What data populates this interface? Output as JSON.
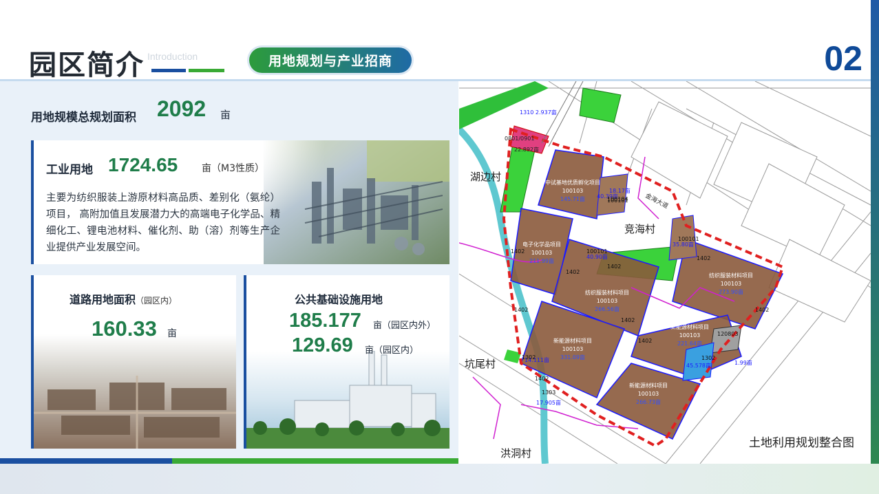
{
  "header": {
    "title": "园区简介",
    "subtitle_en": "Introduction",
    "pill": "用地规划与产业招商",
    "page_number": "02"
  },
  "total": {
    "label": "用地规模总规划面积",
    "value": "2092",
    "unit": "亩"
  },
  "industrial": {
    "label": "工业用地",
    "value": "1724.65",
    "unit": "亩（M3性质）",
    "description": "主要为纺织服装上游原材料高品质、差别化（氨纶）项目， 高附加值且发展潜力大的高端电子化学品、精细化工、锂电池材料、催化剂、助（溶）剂等生产企业提供产业发展空间。"
  },
  "road": {
    "label": "道路用地面积",
    "note": "（园区内）",
    "value": "160.33",
    "unit": "亩"
  },
  "public": {
    "label": "公共基础设施用地",
    "value1": "185.177",
    "unit1": "亩（园区内外）",
    "value2": "129.69",
    "unit2": "亩（园区内）"
  },
  "map": {
    "caption": "土地利用规划整合图",
    "villages": [
      "湖边村",
      "竞海村",
      "坑尾村",
      "洪洞村"
    ],
    "road_name": "金海大道",
    "plots": [
      {
        "name": "中试基地优质孵化项目",
        "code": "100103",
        "area": "145.71亩"
      },
      {
        "name": "电子化学品项目",
        "code": "100103",
        "area": "211.99亩"
      },
      {
        "name": "纺织服装材料项目",
        "code": "100103",
        "area": "266.56亩"
      },
      {
        "name": "纺织服装材料项目",
        "code": "100103",
        "area": "273.90亩"
      },
      {
        "name": "新能源材料项目",
        "code": "100103",
        "area": "331.09亩"
      },
      {
        "name": "新能源材料项目",
        "code": "100103",
        "area": "221.64亩"
      },
      {
        "name": "新能源材料项目",
        "code": "100103",
        "area": "266.73亩"
      }
    ],
    "labels": [
      "1310",
      "2.937亩",
      "0801/0901",
      "22.892亩",
      "100101",
      "40.39亩",
      "18.17亩",
      "100104",
      "100101",
      "35.80亩",
      "100101",
      "40.90亩",
      "100101",
      "1402",
      "1402",
      "1402",
      "1402",
      "1402",
      "1402",
      "1402",
      "1402",
      "120803",
      "1302",
      "45.578亩",
      "1.99亩",
      "1303",
      "17.905亩",
      "14.111亩",
      "1302",
      "302"
    ]
  },
  "colors": {
    "accent_blue": "#0f4a98",
    "accent_green": "#1f7d4a",
    "plot_brown": "#8b5a3c",
    "green_space": "#3bd23b",
    "boundary_red": "#e02020"
  }
}
